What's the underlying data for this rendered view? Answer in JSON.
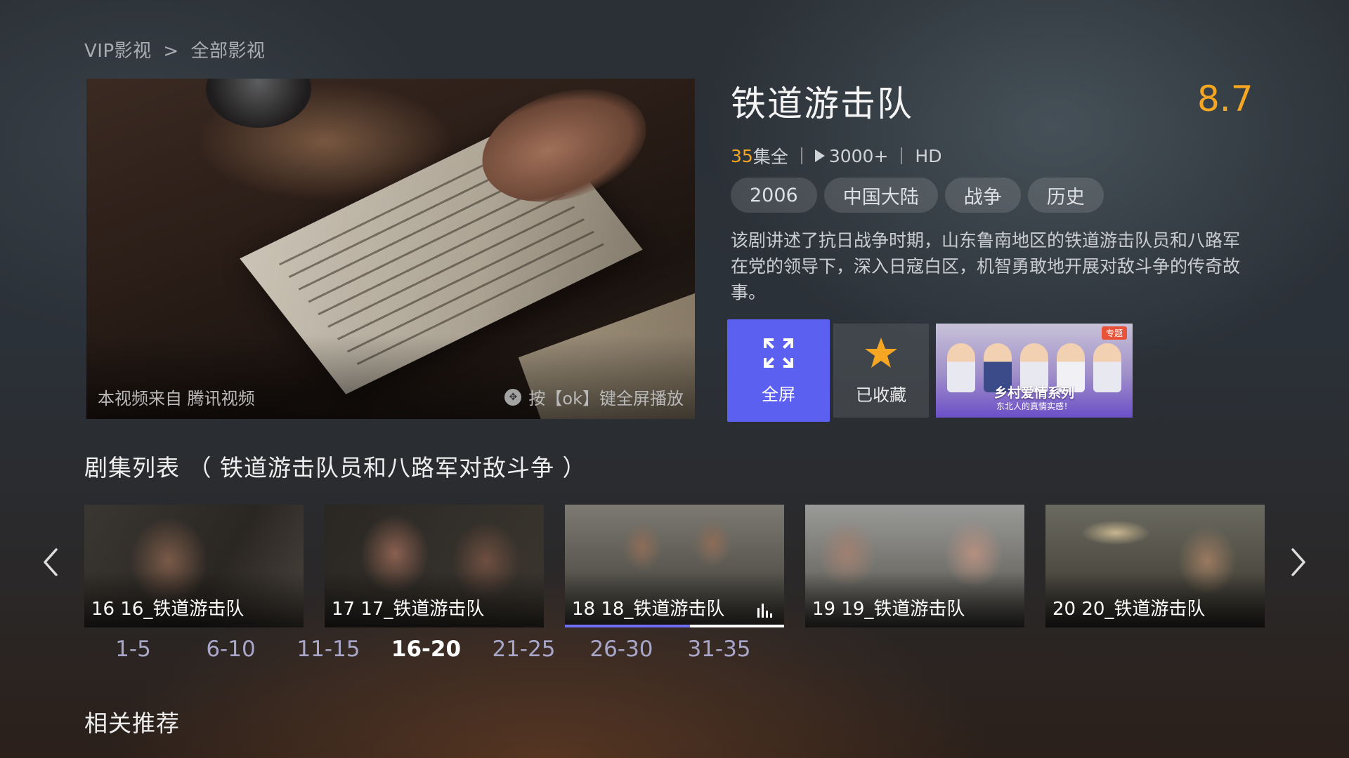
{
  "breadcrumb": {
    "parent": "VIP影视",
    "separator": ">",
    "current": "全部影视"
  },
  "player": {
    "source_text": "本视频来自 腾讯视频",
    "hint_text": "按【ok】键全屏播放"
  },
  "show": {
    "title": "铁道游击队",
    "score": "8.7",
    "episodes_count": "35",
    "episodes_suffix": "集全",
    "plays": "3000+",
    "quality": "HD",
    "tags": [
      "2006",
      "中国大陆",
      "战争",
      "历史"
    ],
    "description": "该剧讲述了抗日战争时期，山东鲁南地区的铁道游击队员和八路军在党的领导下，深入日寇白区，机智勇敢地开展对敌斗争的传奇故事。"
  },
  "actions": {
    "fullscreen_label": "全屏",
    "favorite_label": "已收藏",
    "promo": {
      "badge": "专题",
      "title": "乡村爱情系列",
      "subtitle": "东北人的真情实感！"
    }
  },
  "episode_list": {
    "title": "剧集列表 （ 铁道游击队员和八路军对敌斗争 ）",
    "episodes": [
      {
        "label": "16 16_铁道游击队"
      },
      {
        "label": "17 17_铁道游击队"
      },
      {
        "label": "18 18_铁道游击队",
        "playing": true,
        "progress": 0.57
      },
      {
        "label": "19 19_铁道游击队"
      },
      {
        "label": "20 20_铁道游击队"
      }
    ],
    "ranges": [
      "1-5",
      "6-10",
      "11-15",
      "16-20",
      "21-25",
      "26-30",
      "31-35"
    ],
    "active_range": "16-20"
  },
  "related": {
    "title": "相关推荐"
  },
  "colors": {
    "accent": "#5b60f0",
    "score": "#f5a623",
    "progress": "#6e6ff5"
  },
  "icons": {
    "fullscreen": "expand-arrows-icon",
    "favorite": "star-icon",
    "playing": "equalizer-icon",
    "prev": "chevron-left-icon",
    "next": "chevron-right-icon"
  }
}
